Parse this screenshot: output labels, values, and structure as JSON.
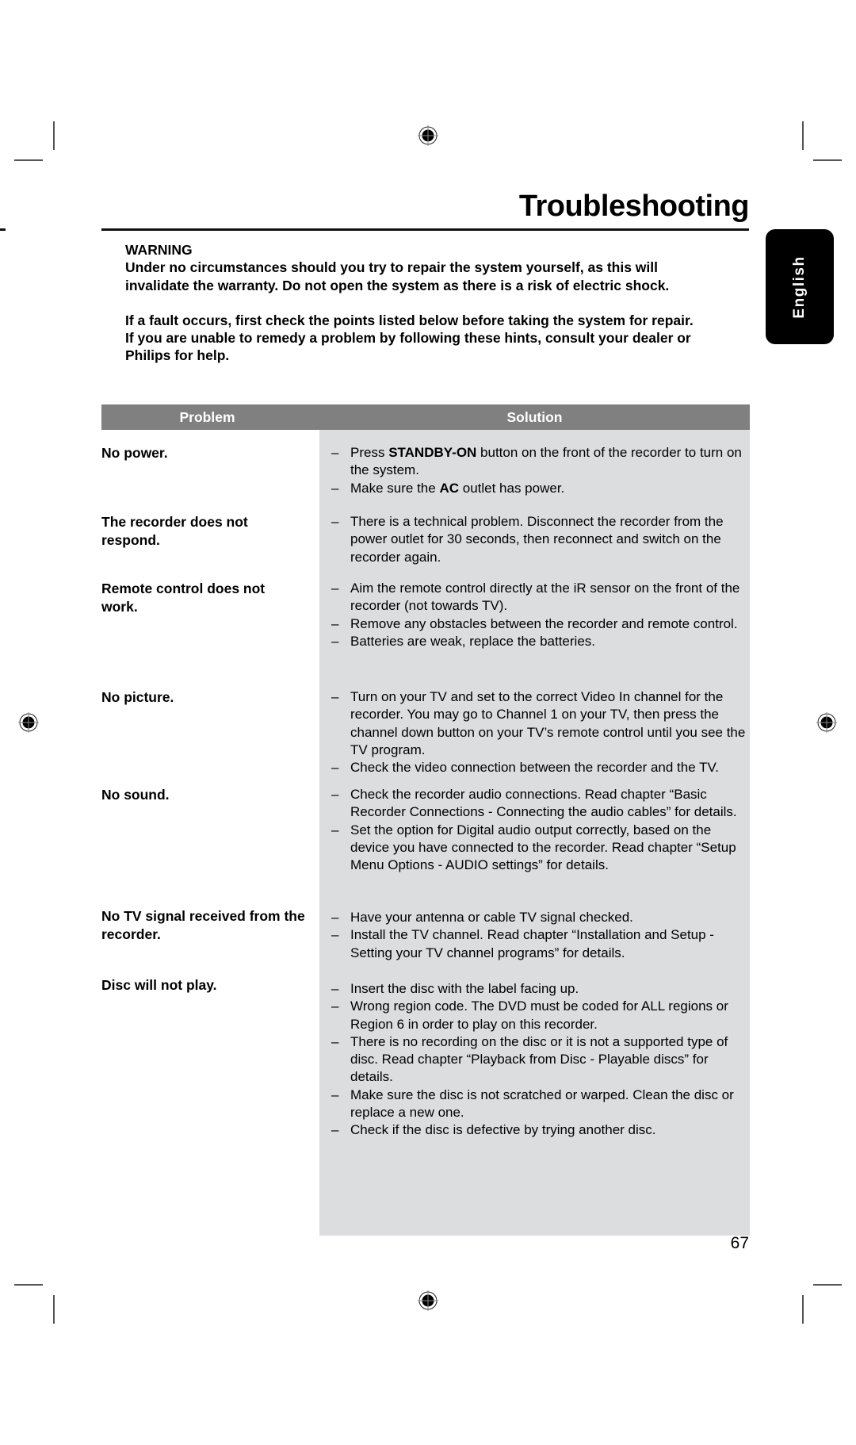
{
  "page": {
    "title": "Troubleshooting",
    "language_tab": "English",
    "page_number": "67"
  },
  "warning": {
    "heading": "WARNING",
    "line1": "Under no circumstances should you try to repair the system yourself, as this will",
    "line2": "invalidate the warranty. Do not open the system as there is a risk of electric shock.",
    "line3": "If a fault occurs, first check the points listed below before taking the system for repair.",
    "line4": "If you are unable to remedy a problem by following these hints, consult your dealer or",
    "line5": "Philips for help."
  },
  "table": {
    "headers": {
      "problem": "Problem",
      "solution": "Solution"
    },
    "rows": [
      {
        "problem": "No power.",
        "solutions": [
          {
            "pre": "Press ",
            "bold": "STANDBY-ON",
            "post": " button on the front of the recorder to turn on the system."
          },
          {
            "pre": "Make sure the ",
            "bold": "AC",
            "post": " outlet has power."
          }
        ]
      },
      {
        "problem": "The recorder does not respond.",
        "solutions": [
          {
            "pre": "There is a technical problem. Disconnect the recorder from the power outlet for 30 seconds, then reconnect and switch on the recorder again.",
            "bold": "",
            "post": ""
          }
        ]
      },
      {
        "problem": "Remote control does not work.",
        "solutions": [
          {
            "pre": "Aim the remote control directly at the iR sensor on the front of the recorder (not towards TV).",
            "bold": "",
            "post": ""
          },
          {
            "pre": "Remove any obstacles between the recorder and remote control.",
            "bold": "",
            "post": ""
          },
          {
            "pre": "Batteries are weak, replace the batteries.",
            "bold": "",
            "post": ""
          }
        ]
      },
      {
        "problem": "No picture.",
        "solutions": [
          {
            "pre": "Turn on your TV and set to the correct Video In channel for the recorder. You may go to Channel 1 on your TV, then press the channel down button on your TV’s remote control until you see the TV program.",
            "bold": "",
            "post": ""
          },
          {
            "pre": "Check the video connection between the recorder and the TV.",
            "bold": "",
            "post": ""
          }
        ]
      },
      {
        "problem": "No sound.",
        "solutions": [
          {
            "pre": "Check the recorder audio connections. Read chapter “Basic Recorder Connections - Connecting the audio cables” for details.",
            "bold": "",
            "post": ""
          },
          {
            "pre": "Set the option for Digital audio output correctly, based on the device you have connected to the recorder. Read chapter “Setup Menu Options - AUDIO settings” for details.",
            "bold": "",
            "post": ""
          }
        ]
      },
      {
        "problem": "No TV signal received from the recorder.",
        "solutions": [
          {
            "pre": "Have your antenna or cable TV signal checked.",
            "bold": "",
            "post": ""
          },
          {
            "pre": "Install the TV channel. Read chapter “Installation and Setup - Setting your TV channel programs” for details.",
            "bold": "",
            "post": ""
          }
        ]
      },
      {
        "problem": "Disc will not play.",
        "solutions": [
          {
            "pre": "Insert the disc with the label facing up.",
            "bold": "",
            "post": ""
          },
          {
            "pre": "Wrong region code. The DVD must be coded for ALL regions or Region 6 in order to play on this recorder.",
            "bold": "",
            "post": ""
          },
          {
            "pre": "There is no recording on the disc or it is not a supported type of disc. Read chapter “Playback from Disc - Playable discs” for details.",
            "bold": "",
            "post": ""
          },
          {
            "pre": "Make sure the disc is not scratched or warped. Clean the disc or replace a new one.",
            "bold": "",
            "post": ""
          },
          {
            "pre": "Check if the disc is defective by trying another disc.",
            "bold": "",
            "post": ""
          }
        ]
      }
    ]
  },
  "bullet_glyph": "–"
}
